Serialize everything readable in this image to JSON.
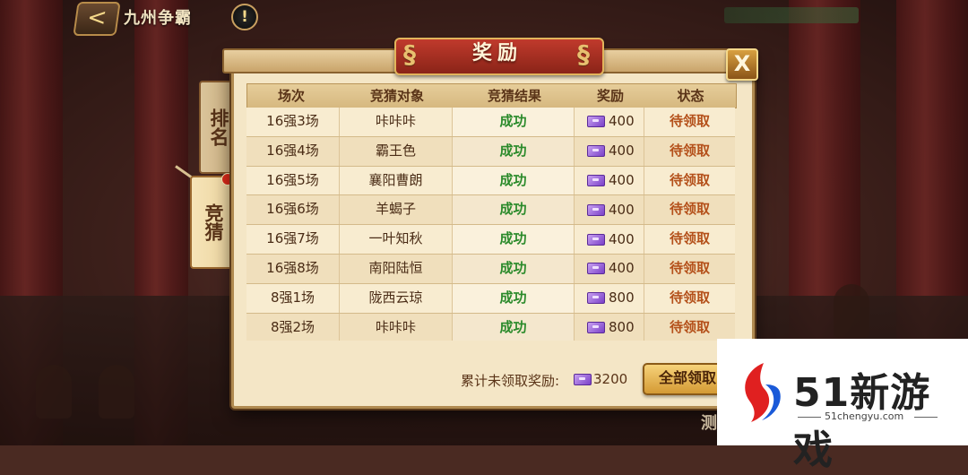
{
  "top_bar": {
    "title": "九州争霸",
    "back_label": "<",
    "info_label": "!"
  },
  "side_tabs": [
    {
      "label": "排名"
    },
    {
      "label": "竞猜"
    }
  ],
  "modal": {
    "title": "奖励",
    "close_label": "X",
    "columns": [
      "场次",
      "竞猜对象",
      "竞猜结果",
      "奖励",
      "状态"
    ],
    "rows": [
      {
        "match": "16强3场",
        "target": "咔咔咔",
        "result": "成功",
        "reward": "400",
        "status": "待领取"
      },
      {
        "match": "16强4场",
        "target": "霸王色",
        "result": "成功",
        "reward": "400",
        "status": "待领取"
      },
      {
        "match": "16强5场",
        "target": "襄阳曹朗",
        "result": "成功",
        "reward": "400",
        "status": "待领取"
      },
      {
        "match": "16强6场",
        "target": "羊蝎子",
        "result": "成功",
        "reward": "400",
        "status": "待领取"
      },
      {
        "match": "16强7场",
        "target": "一叶知秋",
        "result": "成功",
        "reward": "400",
        "status": "待领取"
      },
      {
        "match": "16强8场",
        "target": "南阳陆恒",
        "result": "成功",
        "reward": "400",
        "status": "待领取"
      },
      {
        "match": "8强1场",
        "target": "陇西云琼",
        "result": "成功",
        "reward": "800",
        "status": "待领取"
      },
      {
        "match": "8强2场",
        "target": "咔咔咔",
        "result": "成功",
        "reward": "800",
        "status": "待领取"
      }
    ],
    "footer": {
      "label": "累计未领取奖励:",
      "total": "3200",
      "claim_all_label": "全部领取"
    }
  },
  "watermark": {
    "brand": "51新游戏",
    "url": "51chengyu.com"
  },
  "bottom_corner_text": "测",
  "colors": {
    "success": "#2a8a2a",
    "pending": "#b4501a",
    "header_red": "#c03a2c"
  },
  "icons": {
    "reward": "ticket-icon",
    "back": "back-arrow-icon",
    "info": "info-icon",
    "close": "close-icon"
  }
}
